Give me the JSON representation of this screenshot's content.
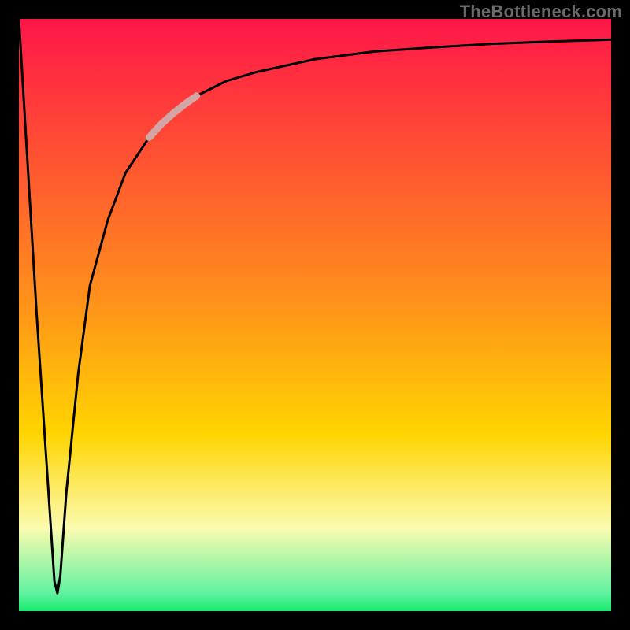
{
  "watermark": "TheBottleneck.com",
  "colors": {
    "top": "#ff1648",
    "mid": "#ffd400",
    "paleYellow": "#fbfbb0",
    "bottom": "#1ae96e",
    "curve": "#000000",
    "highlight": "#d2a6a6",
    "frame": "#000000"
  },
  "chart_data": {
    "type": "line",
    "title": "",
    "xlabel": "",
    "ylabel": "",
    "xlim": [
      0,
      100
    ],
    "ylim": [
      0,
      100
    ],
    "legend": [],
    "annotations": [],
    "grid": false,
    "series": [
      {
        "name": "curve",
        "x": [
          0,
          3,
          6,
          6.5,
          7,
          8,
          10,
          12,
          15,
          18,
          22,
          26,
          30,
          35,
          40,
          50,
          60,
          70,
          80,
          90,
          100
        ],
        "y": [
          100,
          50,
          5,
          3,
          6,
          20,
          40,
          55,
          66,
          74,
          80,
          84,
          87,
          89.5,
          91,
          93.2,
          94.5,
          95.2,
          95.8,
          96.2,
          96.5
        ]
      },
      {
        "name": "highlight-segment",
        "x": [
          22,
          24,
          26,
          28,
          30
        ],
        "y": [
          80,
          82.2,
          84,
          85.6,
          87
        ]
      }
    ]
  }
}
